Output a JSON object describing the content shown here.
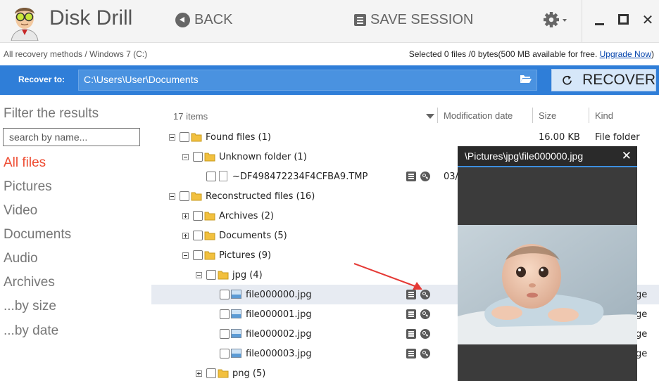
{
  "app": {
    "title": "Disk Drill"
  },
  "toolbar": {
    "back_label": "BACK",
    "save_session_label": "SAVE SESSION"
  },
  "status": {
    "breadcrumb": [
      "All recovery methods",
      "Windows 7 (C:)"
    ],
    "breadcrumb_sep": " / ",
    "selection_text": "Selected 0 files /0 bytes(500 MB available for free.",
    "upgrade_link": "Upgrade Now",
    "selection_suffix": ")"
  },
  "recover": {
    "label": "Recover to:",
    "path": "C:\\Users\\User\\Documents",
    "button_label": "RECOVER"
  },
  "sidebar": {
    "filter_title": "Filter the results",
    "search_placeholder": "search by name...",
    "categories": [
      {
        "label": "All files",
        "active": true
      },
      {
        "label": "Pictures"
      },
      {
        "label": "Video"
      },
      {
        "label": "Documents"
      },
      {
        "label": "Audio"
      },
      {
        "label": "Archives"
      },
      {
        "label": "...by size"
      },
      {
        "label": "...by date"
      }
    ]
  },
  "list": {
    "item_count": "17 items",
    "columns": {
      "date": "Modification date",
      "size": "Size",
      "kind": "Kind"
    },
    "rows": [
      {
        "label": "Found files",
        "count": "(1)",
        "size": "16.00 KB",
        "kind": "File folder"
      },
      {
        "label": "Unknown folder",
        "count": "(1)"
      },
      {
        "label": "~DF498472234F4CFBA9.TMP",
        "date": "03/"
      },
      {
        "label": "Reconstructed files",
        "count": "(16)"
      },
      {
        "label": "Archives",
        "count": "(2)"
      },
      {
        "label": "Documents",
        "count": "(5)"
      },
      {
        "label": "Pictures",
        "count": "(9)"
      },
      {
        "label": "jpg",
        "count": "(4)"
      },
      {
        "label": "file000000.jpg",
        "kind": "ge"
      },
      {
        "label": "file000001.jpg",
        "kind": "ge"
      },
      {
        "label": "file000002.jpg",
        "kind": "ge"
      },
      {
        "label": "file000003.jpg",
        "kind": "ge"
      },
      {
        "label": "png",
        "count": "(5)"
      }
    ]
  },
  "preview": {
    "title": "\\Pictures\\jpg\\file000000.jpg"
  },
  "colors": {
    "accent_blue": "#2f7ed8",
    "active_category": "#ee4c32",
    "annotation_arrow": "#e53935"
  }
}
